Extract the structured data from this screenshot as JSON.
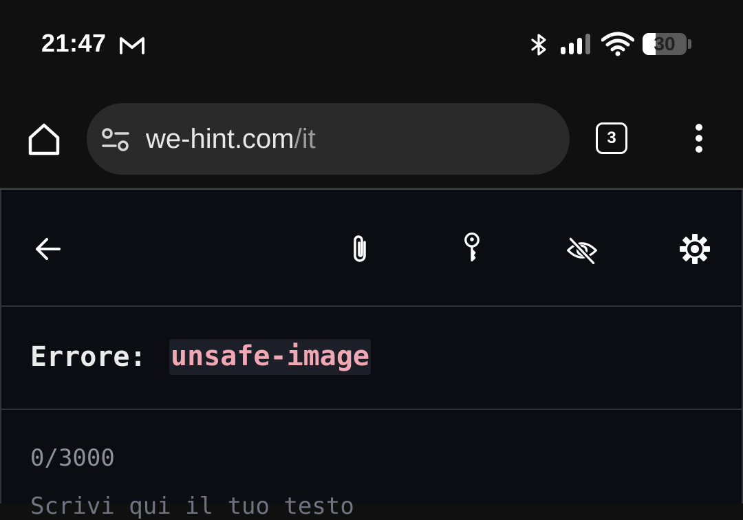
{
  "status_bar": {
    "time": "21:47",
    "notification_icons": [
      "gmail-icon"
    ],
    "system_icons": [
      "bluetooth-icon",
      "cellular-signal-icon",
      "wifi-icon"
    ],
    "battery_percent": 30
  },
  "browser": {
    "url_domain": "we-hint.com",
    "url_path": "/it",
    "tab_count": "3",
    "icons": [
      "home-icon",
      "site-settings-icon",
      "tab-switcher-icon",
      "more-vert-icon"
    ]
  },
  "app": {
    "toolbar_icons": [
      "arrow-back-icon",
      "attachment-icon",
      "key-icon",
      "visibility-off-icon",
      "settings-gear-icon"
    ],
    "error": {
      "label": "Errore:",
      "code": "unsafe-image"
    },
    "char_counter": "0/3000",
    "textarea_placeholder": "Scrivi qui il tuo testo"
  },
  "colors": {
    "background": "#101010",
    "content_background": "#0c0d12",
    "omnibox": "#2a2a2a",
    "error_code_text": "#f0a8b4",
    "error_code_bg": "#1c1f28",
    "counter_text": "#8c919c"
  }
}
